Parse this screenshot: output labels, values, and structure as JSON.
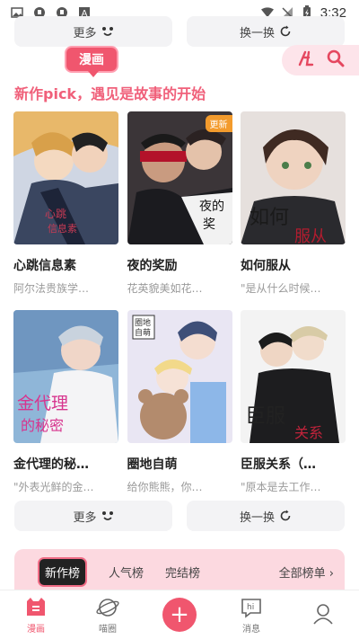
{
  "status_bar": {
    "time": "3:32"
  },
  "top_buttons": {
    "more_label": "更多",
    "refresh_label": "换一换"
  },
  "manga_tag": "漫画",
  "section_title": "新作pick，遇见是故事的开始",
  "comics": [
    {
      "title": "心跳信息素",
      "desc": "阿尔法贵族学…",
      "badge": ""
    },
    {
      "title": "夜的奖励",
      "desc": "花英貌美如花…",
      "badge": "更新"
    },
    {
      "title": "如何服从",
      "desc": "\"是从什么时候…",
      "badge": ""
    },
    {
      "title": "金代理的秘…",
      "desc": "\"外表光鲜的金…",
      "badge": ""
    },
    {
      "title": "圈地自萌",
      "desc": "给你熊熊，你…",
      "badge": ""
    },
    {
      "title": "臣服关系（…",
      "desc": "\"原本是去工作…",
      "badge": ""
    }
  ],
  "bottom_buttons": {
    "more_label": "更多",
    "refresh_label": "换一换"
  },
  "rank_tabs": [
    "新作榜",
    "人气榜",
    "完结榜"
  ],
  "rank_all": "全部榜单 ›",
  "nav": [
    {
      "label": "漫画",
      "icon": "manga-icon"
    },
    {
      "label": "喵圈",
      "icon": "planet-icon"
    },
    {
      "label": "",
      "icon": "plus-icon"
    },
    {
      "label": "消息",
      "icon": "message-icon"
    },
    {
      "label": "",
      "icon": "profile-icon"
    }
  ],
  "colors": {
    "accent": "#f0566e",
    "title_pink": "#f0607a",
    "rank_bg": "#fcd9e0"
  }
}
